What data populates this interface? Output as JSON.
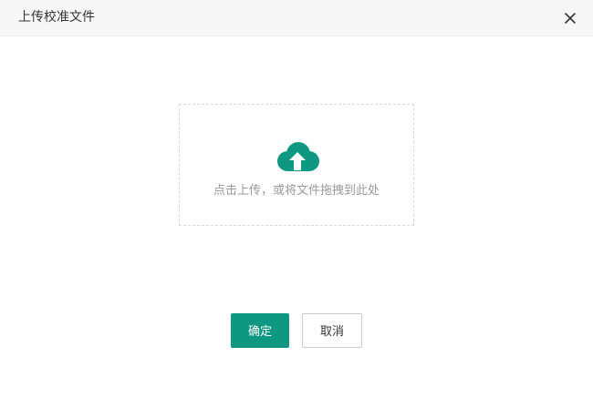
{
  "dialog": {
    "title": "上传校准文件",
    "close_icon": "close-icon"
  },
  "upload": {
    "icon": "cloud-upload-icon",
    "hint": "点击上传，或将文件拖拽到此处"
  },
  "footer": {
    "confirm_label": "确定",
    "cancel_label": "取消"
  },
  "colors": {
    "accent": "#0e9882",
    "header_bg": "#f7f7f7",
    "hint_text": "#999999"
  }
}
